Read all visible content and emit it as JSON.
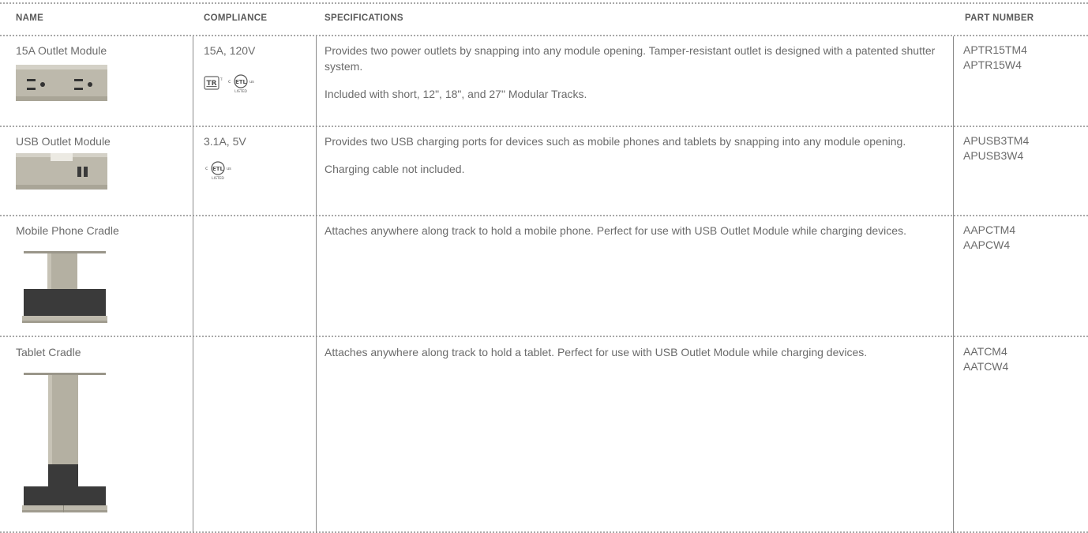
{
  "headers": {
    "name": "NAME",
    "compliance": "COMPLIANCE",
    "specifications": "SPECIFICATIONS",
    "part_number": "PART NUMBER"
  },
  "rows": [
    {
      "name": "15A Outlet Module",
      "compliance": "15A, 120V",
      "certs": [
        "TR",
        "c ETL us LISTED"
      ],
      "spec": [
        "Provides two power outlets by snapping into any module opening.  Tamper-resistant outlet is designed with a patented shutter system.",
        "Included with short, 12\", 18\", and 27\" Modular Tracks."
      ],
      "parts": [
        "APTR15TM4",
        "APTR15W4"
      ]
    },
    {
      "name": "USB Outlet Module",
      "compliance": "3.1A, 5V",
      "certs": [
        "c ETL us LISTED"
      ],
      "spec": [
        "Provides two USB charging ports for devices such as mobile phones and tablets by snapping into any module opening.",
        "Charging cable not included."
      ],
      "parts": [
        "APUSB3TM4",
        "APUSB3W4"
      ]
    },
    {
      "name": "Mobile Phone Cradle",
      "compliance": "",
      "spec": [
        "Attaches anywhere along track to hold a mobile phone.  Perfect for use with USB Outlet Module while charging devices."
      ],
      "parts": [
        "AAPCTM4",
        "AAPCW4"
      ]
    },
    {
      "name": "Tablet Cradle",
      "compliance": "",
      "spec": [
        "Attaches anywhere along track to hold a tablet.  Perfect for use with USB Outlet Module while charging devices."
      ],
      "parts": [
        "AATCM4",
        "AATCW4"
      ]
    }
  ],
  "colors": {
    "product_body": "#b5b1a4",
    "product_dark": "#3b3b3b",
    "text": "#6b6b6b",
    "rule": "#a9a9a9"
  }
}
